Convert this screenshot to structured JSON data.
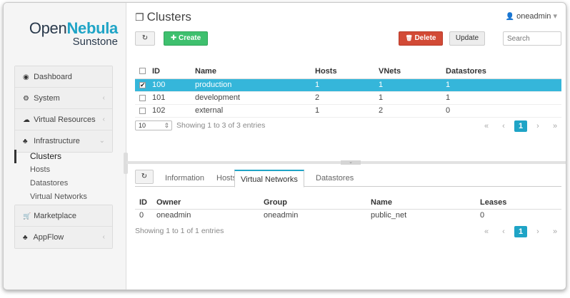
{
  "logo": {
    "brand_a": "Open",
    "brand_b": "Nebula",
    "product": "Sunstone"
  },
  "sidebar": {
    "items": [
      {
        "icon": "dashboard-icon",
        "glyph": "◉",
        "label": "Dashboard"
      },
      {
        "icon": "cogs-icon",
        "glyph": "⚙",
        "label": "System",
        "arrow": "‹"
      },
      {
        "icon": "cloud-icon",
        "glyph": "☁",
        "label": "Virtual Resources",
        "arrow": "‹"
      },
      {
        "icon": "sitemap-icon",
        "glyph": "♣",
        "label": "Infrastructure",
        "arrow": "⌄"
      }
    ],
    "sub_items": [
      "Clusters",
      "Hosts",
      "Datastores",
      "Virtual Networks"
    ],
    "bottom_items": [
      {
        "icon": "cart-icon",
        "glyph": "🛒",
        "label": "Marketplace"
      },
      {
        "icon": "sitemap-icon",
        "glyph": "♣",
        "label": "AppFlow",
        "arrow": "‹"
      }
    ]
  },
  "header": {
    "title": "Clusters",
    "title_icon": "clone-icon",
    "title_glyph": "❐",
    "user": "oneadmin",
    "user_caret": "▾",
    "user_glyph": "👤"
  },
  "toolbar": {
    "refresh_glyph": "↻",
    "create_label": "Create",
    "create_glyph": "✚",
    "delete_label": "Delete",
    "delete_glyph": "🗑",
    "update_label": "Update",
    "search_placeholder": "Search"
  },
  "clusters_table": {
    "columns": [
      "ID",
      "Name",
      "Hosts",
      "VNets",
      "Datastores"
    ],
    "rows": [
      {
        "id": "100",
        "name": "production",
        "hosts": "1",
        "vnets": "1",
        "datastores": "1",
        "selected": true
      },
      {
        "id": "101",
        "name": "development",
        "hosts": "2",
        "vnets": "1",
        "datastores": "1",
        "selected": false
      },
      {
        "id": "102",
        "name": "external",
        "hosts": "1",
        "vnets": "2",
        "datastores": "0",
        "selected": false
      }
    ]
  },
  "pager_top": {
    "page_length": "10",
    "info": "Showing 1 to 3 of 3 entries",
    "first": "«",
    "prev": "‹",
    "current": "1",
    "next": "›",
    "last": "»"
  },
  "detail_tabs": [
    "Information",
    "Hosts",
    "Virtual Networks",
    "Datastores"
  ],
  "active_tab": "Virtual Networks",
  "vnet_table": {
    "columns": [
      "ID",
      "Owner",
      "Group",
      "Name",
      "Leases"
    ],
    "rows": [
      {
        "id": "0",
        "owner": "oneadmin",
        "group": "oneadmin",
        "name": "public_net",
        "leases": "0"
      }
    ]
  },
  "pager_bottom": {
    "info": "Showing 1 to 1 of 1 entries",
    "first": "«",
    "prev": "‹",
    "current": "1",
    "next": "›",
    "last": "»"
  },
  "colors": {
    "accent": "#1fa4c6",
    "selected_row": "#35b6da",
    "create": "#3ec06e",
    "delete": "#d24a36"
  }
}
